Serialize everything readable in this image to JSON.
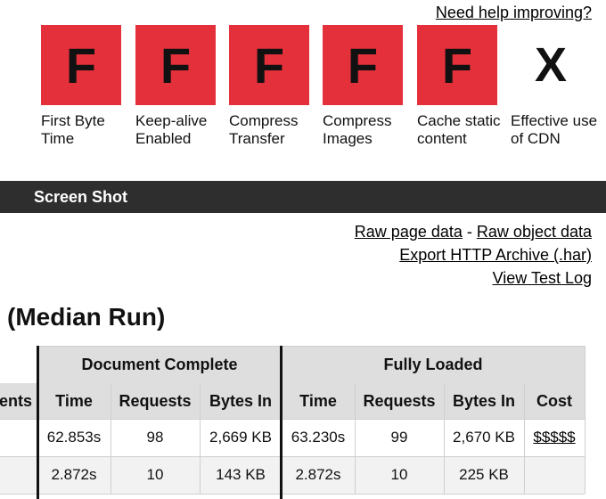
{
  "help_link": "Need help improving?",
  "grades": [
    {
      "letter": "F",
      "label": "First Byte Time",
      "status": "fail"
    },
    {
      "letter": "F",
      "label": "Keep-alive Enabled",
      "status": "fail"
    },
    {
      "letter": "F",
      "label": "Compress Transfer",
      "status": "fail"
    },
    {
      "letter": "F",
      "label": "Compress Images",
      "status": "fail"
    },
    {
      "letter": "F",
      "label": "Cache static content",
      "status": "fail"
    },
    {
      "letter": "X",
      "label": "Effective use of CDN",
      "status": "na"
    }
  ],
  "colors": {
    "fail": "#e3303a",
    "bar": "#2e2e2e",
    "header": "#dedede"
  },
  "section_bar": "Screen Shot",
  "links": {
    "raw_page": "Raw page data",
    "separator": "-",
    "raw_object": "Raw object data",
    "har": "Export HTTP Archive (.har)",
    "log": "View Test Log"
  },
  "median_title": "(Median Run)",
  "table": {
    "group_headers": [
      "Document Complete",
      "Fully Loaded"
    ],
    "columns": [
      "ents",
      "Time",
      "Requests",
      "Bytes In",
      "Time",
      "Requests",
      "Bytes In",
      "Cost"
    ],
    "rows": [
      [
        "",
        "62.853s",
        "98",
        "2,669 KB",
        "63.230s",
        "99",
        "2,670 KB",
        "$$$$$"
      ],
      [
        "",
        "2.872s",
        "10",
        "143 KB",
        "2.872s",
        "10",
        "225 KB",
        ""
      ]
    ]
  }
}
